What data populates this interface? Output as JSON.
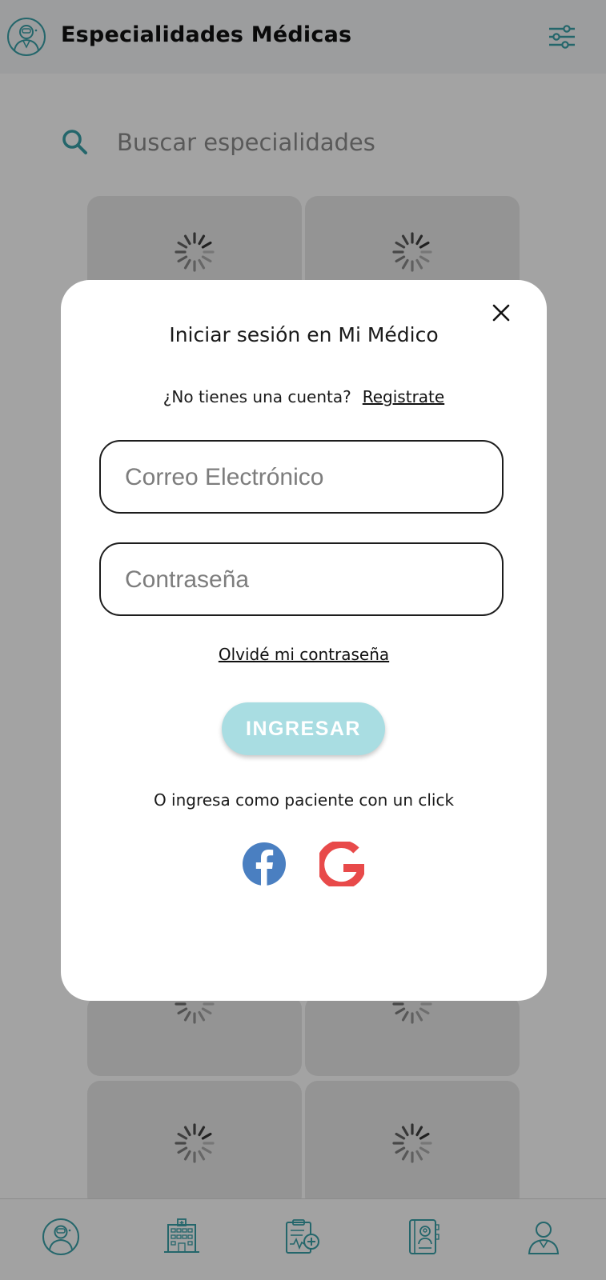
{
  "header": {
    "title": "Especialidades Médicas"
  },
  "search": {
    "placeholder": "Buscar especialidades"
  },
  "modal": {
    "title": "Iniciar sesión en Mi Médico",
    "no_account_text": "¿No tienes una cuenta?",
    "register_link": "Registrate",
    "email_placeholder": "Correo Electrónico",
    "password_placeholder": "Contraseña",
    "forgot_password": "Olvidé mi contraseña",
    "submit_label": "INGRESAR",
    "social_caption": "O ingresa como paciente con un click"
  },
  "icons": {
    "header_avatar": "doctor-avatar-icon",
    "filter": "sliders-icon",
    "search": "search-icon",
    "close": "close-icon",
    "facebook": "facebook-icon",
    "google": "google-icon",
    "nav": [
      "doctor-icon",
      "hospital-icon",
      "clipboard-medical-icon",
      "address-book-icon",
      "user-icon"
    ]
  },
  "colors": {
    "accent": "#39a0a8",
    "button": "#a9dde2",
    "facebook": "#4a7fc1",
    "google": "#e84a4a",
    "card": "#e8e8e8"
  }
}
